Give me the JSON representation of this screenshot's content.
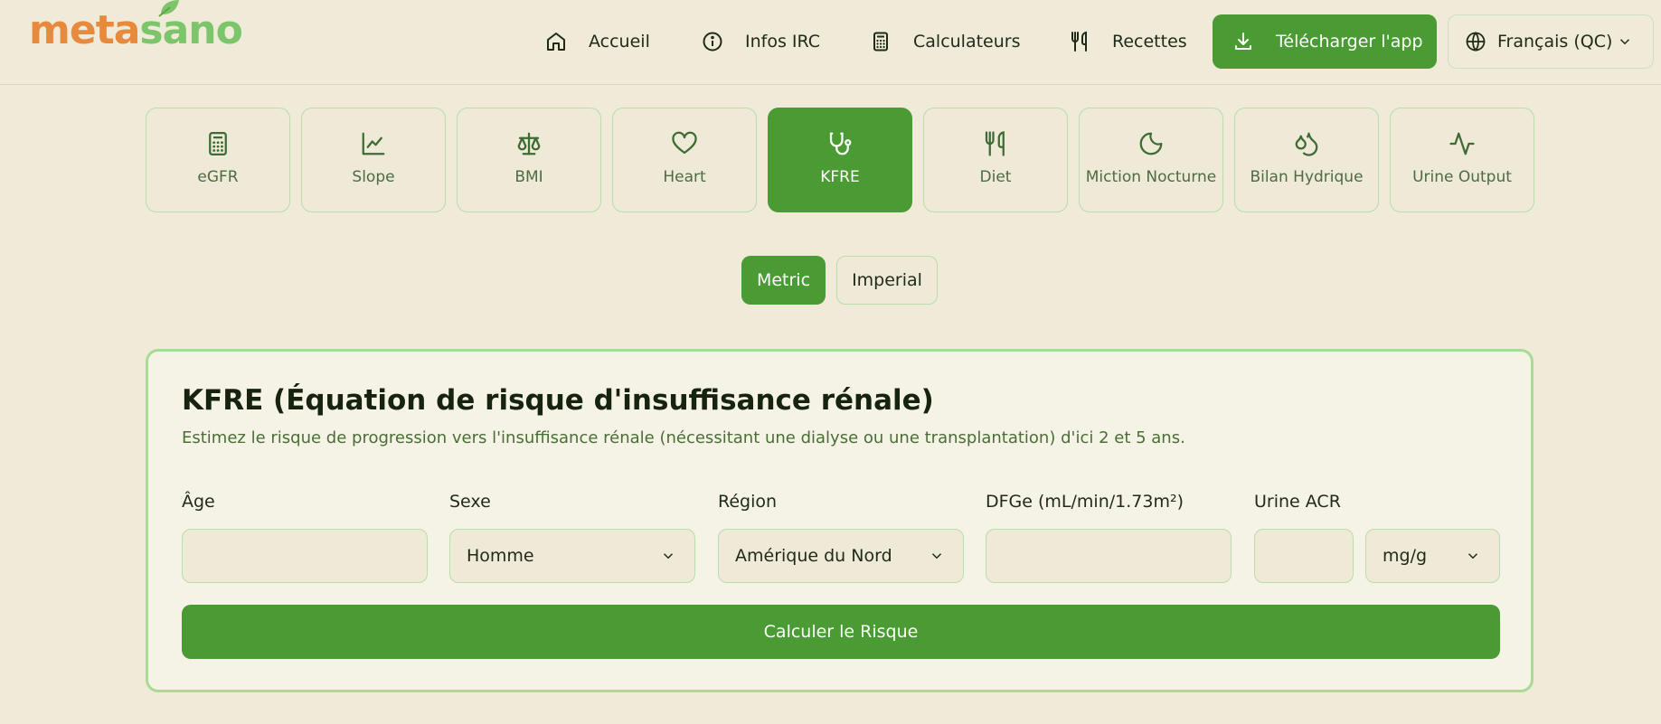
{
  "brand": {
    "part1": "meta",
    "part2": "sano"
  },
  "nav": {
    "items": [
      {
        "label": "Accueil",
        "icon": "home-icon"
      },
      {
        "label": "Infos IRC",
        "icon": "info-icon"
      },
      {
        "label": "Calculateurs",
        "icon": "calculator-icon"
      },
      {
        "label": "Recettes",
        "icon": "utensils-icon"
      }
    ],
    "download_label": "Télécharger l'app",
    "language": "Français (QC)"
  },
  "tabs": [
    {
      "label": "eGFR",
      "icon": "calculator-icon",
      "active": false
    },
    {
      "label": "Slope",
      "icon": "line-chart-icon",
      "active": false
    },
    {
      "label": "BMI",
      "icon": "scale-icon",
      "active": false
    },
    {
      "label": "Heart",
      "icon": "heart-icon",
      "active": false
    },
    {
      "label": "KFRE",
      "icon": "stethoscope-icon",
      "active": true
    },
    {
      "label": "Diet",
      "icon": "utensils-icon",
      "active": false
    },
    {
      "label": "Miction Nocturne",
      "icon": "moon-icon",
      "active": false
    },
    {
      "label": "Bilan Hydrique",
      "icon": "droplets-icon",
      "active": false
    },
    {
      "label": "Urine Output",
      "icon": "activity-icon",
      "active": false
    }
  ],
  "units": {
    "metric": "Metric",
    "imperial": "Imperial",
    "selected": "Metric"
  },
  "card": {
    "title": "KFRE (Équation de risque d'insuffisance rénale)",
    "subtitle": "Estimez le risque de progression vers l'insuffisance rénale (nécessitant une dialyse ou une transplantation) d'ici 2 et 5 ans.",
    "fields": {
      "age_label": "Âge",
      "age_value": "",
      "sex_label": "Sexe",
      "sex_value": "Homme",
      "region_label": "Région",
      "region_value": "Amérique du Nord",
      "egfr_label": "DFGe (mL/min/1.73m²)",
      "egfr_value": "",
      "acr_label": "Urine ACR",
      "acr_value": "",
      "acr_unit": "mg/g"
    },
    "button_label": "Calculer le Risque"
  },
  "colors": {
    "accent": "#4a9b34",
    "background": "#f0ead9",
    "border": "#b9deaa"
  }
}
